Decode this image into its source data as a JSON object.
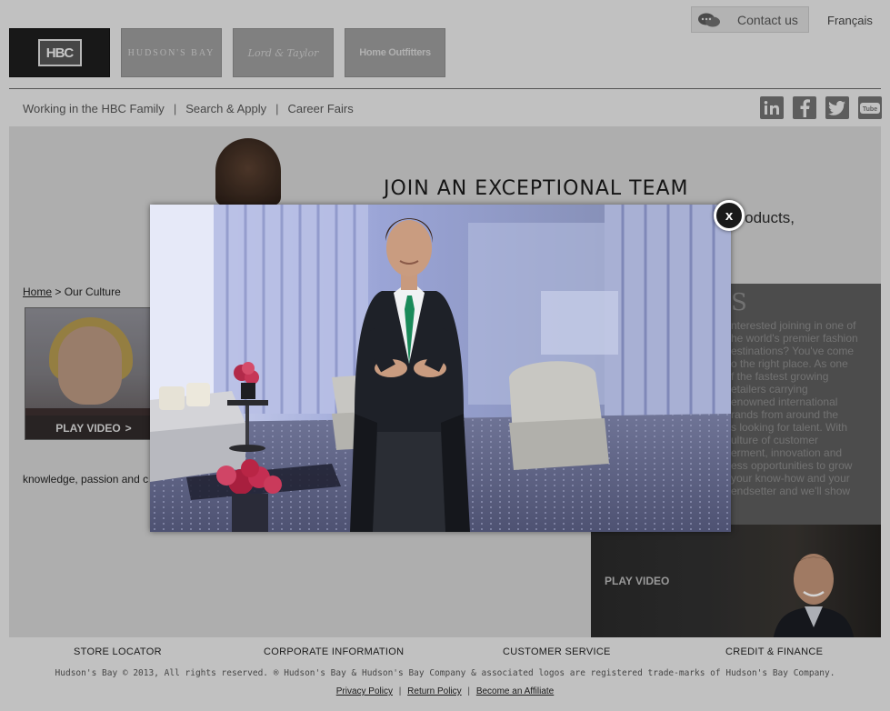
{
  "header": {
    "contact_label": "Contact us",
    "language_link": "Français",
    "brand_tabs": [
      {
        "label": "HBC"
      },
      {
        "label": "HUDSON'S BAY"
      },
      {
        "label": "Lord & Taylor"
      },
      {
        "label": "Home Outfitters"
      }
    ]
  },
  "subnav": {
    "items": [
      "Working in the HBC Family",
      "Search & Apply",
      "Career Fairs"
    ],
    "separator": "|"
  },
  "social": [
    "linkedin-icon",
    "facebook-icon",
    "twitter-icon",
    "youtube-icon"
  ],
  "hero": {
    "title": "JOIN AN EXCEPTIONAL TEAM",
    "subtitle_fragment": "products,"
  },
  "breadcrumb": {
    "home": "Home",
    "separator": ">",
    "current": "Our Culture"
  },
  "thumbnail": {
    "play_label": "PLAY VIDEO",
    "play_arrow": ">"
  },
  "body_snippet": "knowledge, passion and c",
  "side_panel": {
    "heading_fragment": "S",
    "text_lines": [
      "nterested joining in one of",
      "he world's premier fashion",
      "estinations? You've come",
      "o the right place. As one",
      "f the fastest growing",
      "etailers carrying",
      "enowned international",
      "rands from around the",
      "s looking for talent. With",
      "ulture of customer",
      "erment, innovation and",
      "ess opportunities to grow",
      "your know-how and your",
      "endsetter and we'll show"
    ]
  },
  "side_video": {
    "play_label": "PLAY VIDEO"
  },
  "footer": {
    "nav": [
      "STORE LOCATOR",
      "CORPORATE INFORMATION",
      "CUSTOMER SERVICE",
      "CREDIT & FINANCE"
    ],
    "copyright": "Hudson's Bay © 2013, All rights reserved. ® Hudson's Bay & Hudson's Bay Company & associated logos are registered trade-marks of Hudson's Bay Company.",
    "links": [
      "Privacy Policy",
      "Return Policy",
      "Become an Affiliate"
    ],
    "link_separator": "|"
  },
  "modal": {
    "close_label": "x"
  },
  "colors": {
    "page_bg": "#e8e8e8",
    "overlay": "#000000",
    "active_tab": "#1e1e1e"
  }
}
